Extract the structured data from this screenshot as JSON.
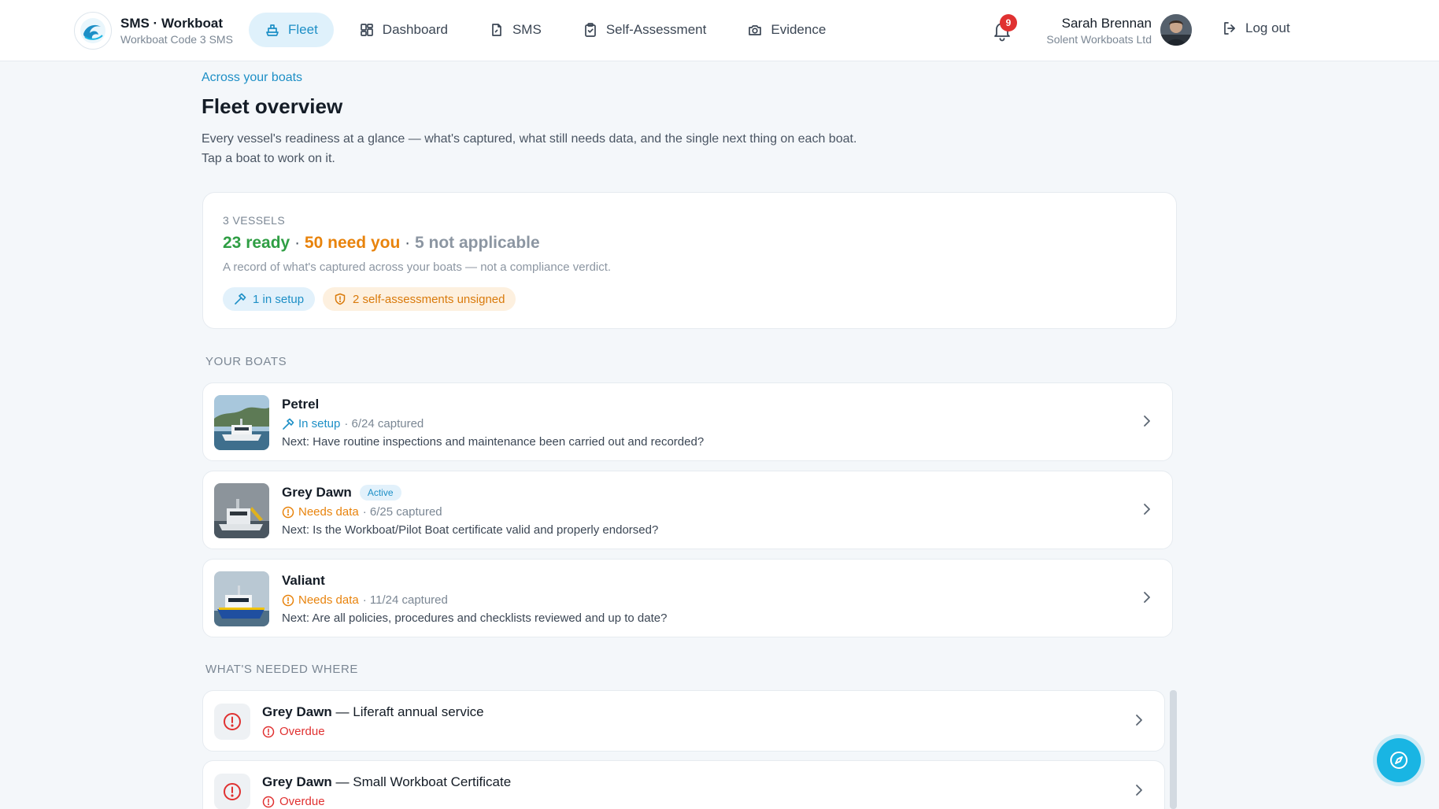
{
  "brand": {
    "title": "SMS · Workboat",
    "subtitle": "Workboat Code 3 SMS"
  },
  "nav": {
    "fleet": "Fleet",
    "dashboard": "Dashboard",
    "sms": "SMS",
    "self_assessment": "Self-Assessment",
    "evidence": "Evidence"
  },
  "notifications": {
    "count": "9"
  },
  "user": {
    "name": "Sarah Brennan",
    "org": "Solent Workboats Ltd"
  },
  "logout_label": "Log out",
  "page": {
    "kicker": "Across your boats",
    "title": "Fleet overview",
    "description": "Every vessel's readiness at a glance — what's captured, what still needs data, and the single next thing on each boat. Tap a boat to work on it."
  },
  "summary": {
    "count_label": "3 VESSELS",
    "ready": "23 ready",
    "need": "50 need you",
    "na": "5 not applicable",
    "separator": "·",
    "note": "A record of what's captured across your boats — not a compliance verdict.",
    "chip_setup": "1 in setup",
    "chip_unsigned": "2 self-assessments unsigned"
  },
  "sections": {
    "boats": "YOUR BOATS",
    "needed": "WHAT'S NEEDED WHERE"
  },
  "boats": [
    {
      "name": "Petrel",
      "badge": "",
      "status": "In setup",
      "captured": "· 6/24 captured",
      "next": "Next: Have routine inspections and maintenance been carried out and recorded?"
    },
    {
      "name": "Grey Dawn",
      "badge": "Active",
      "status": "Needs data",
      "captured": "· 6/25 captured",
      "next": "Next: Is the Workboat/Pilot Boat certificate valid and properly endorsed?"
    },
    {
      "name": "Valiant",
      "badge": "",
      "status": "Needs data",
      "captured": "· 11/24 captured",
      "next": "Next: Are all policies, procedures and checklists reviewed and up to date?"
    }
  ],
  "needs": [
    {
      "vessel": "Grey Dawn",
      "item": " — Liferaft annual service",
      "status": "Overdue"
    },
    {
      "vessel": "Grey Dawn",
      "item": " — Small Workboat Certificate",
      "status": "Overdue"
    }
  ],
  "colors": {
    "accent": "#1d8fc6",
    "ready": "#2f9e44",
    "need": "#e8830c",
    "na": "#8c96a2",
    "overdue": "#e03131"
  }
}
